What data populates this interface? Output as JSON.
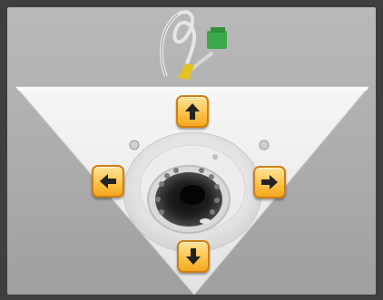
{
  "camera_view": {
    "feed_icon": "dome-camera-image"
  },
  "ptz_controls": {
    "up_icon": "arrow-up-icon",
    "left_icon": "arrow-left-icon",
    "right_icon": "arrow-right-icon",
    "down_icon": "arrow-down-icon"
  },
  "colors": {
    "frame": "#3f3f3f",
    "button_fill": "#ffc34b",
    "button_border": "#d07e12",
    "arrow": "#222222"
  }
}
